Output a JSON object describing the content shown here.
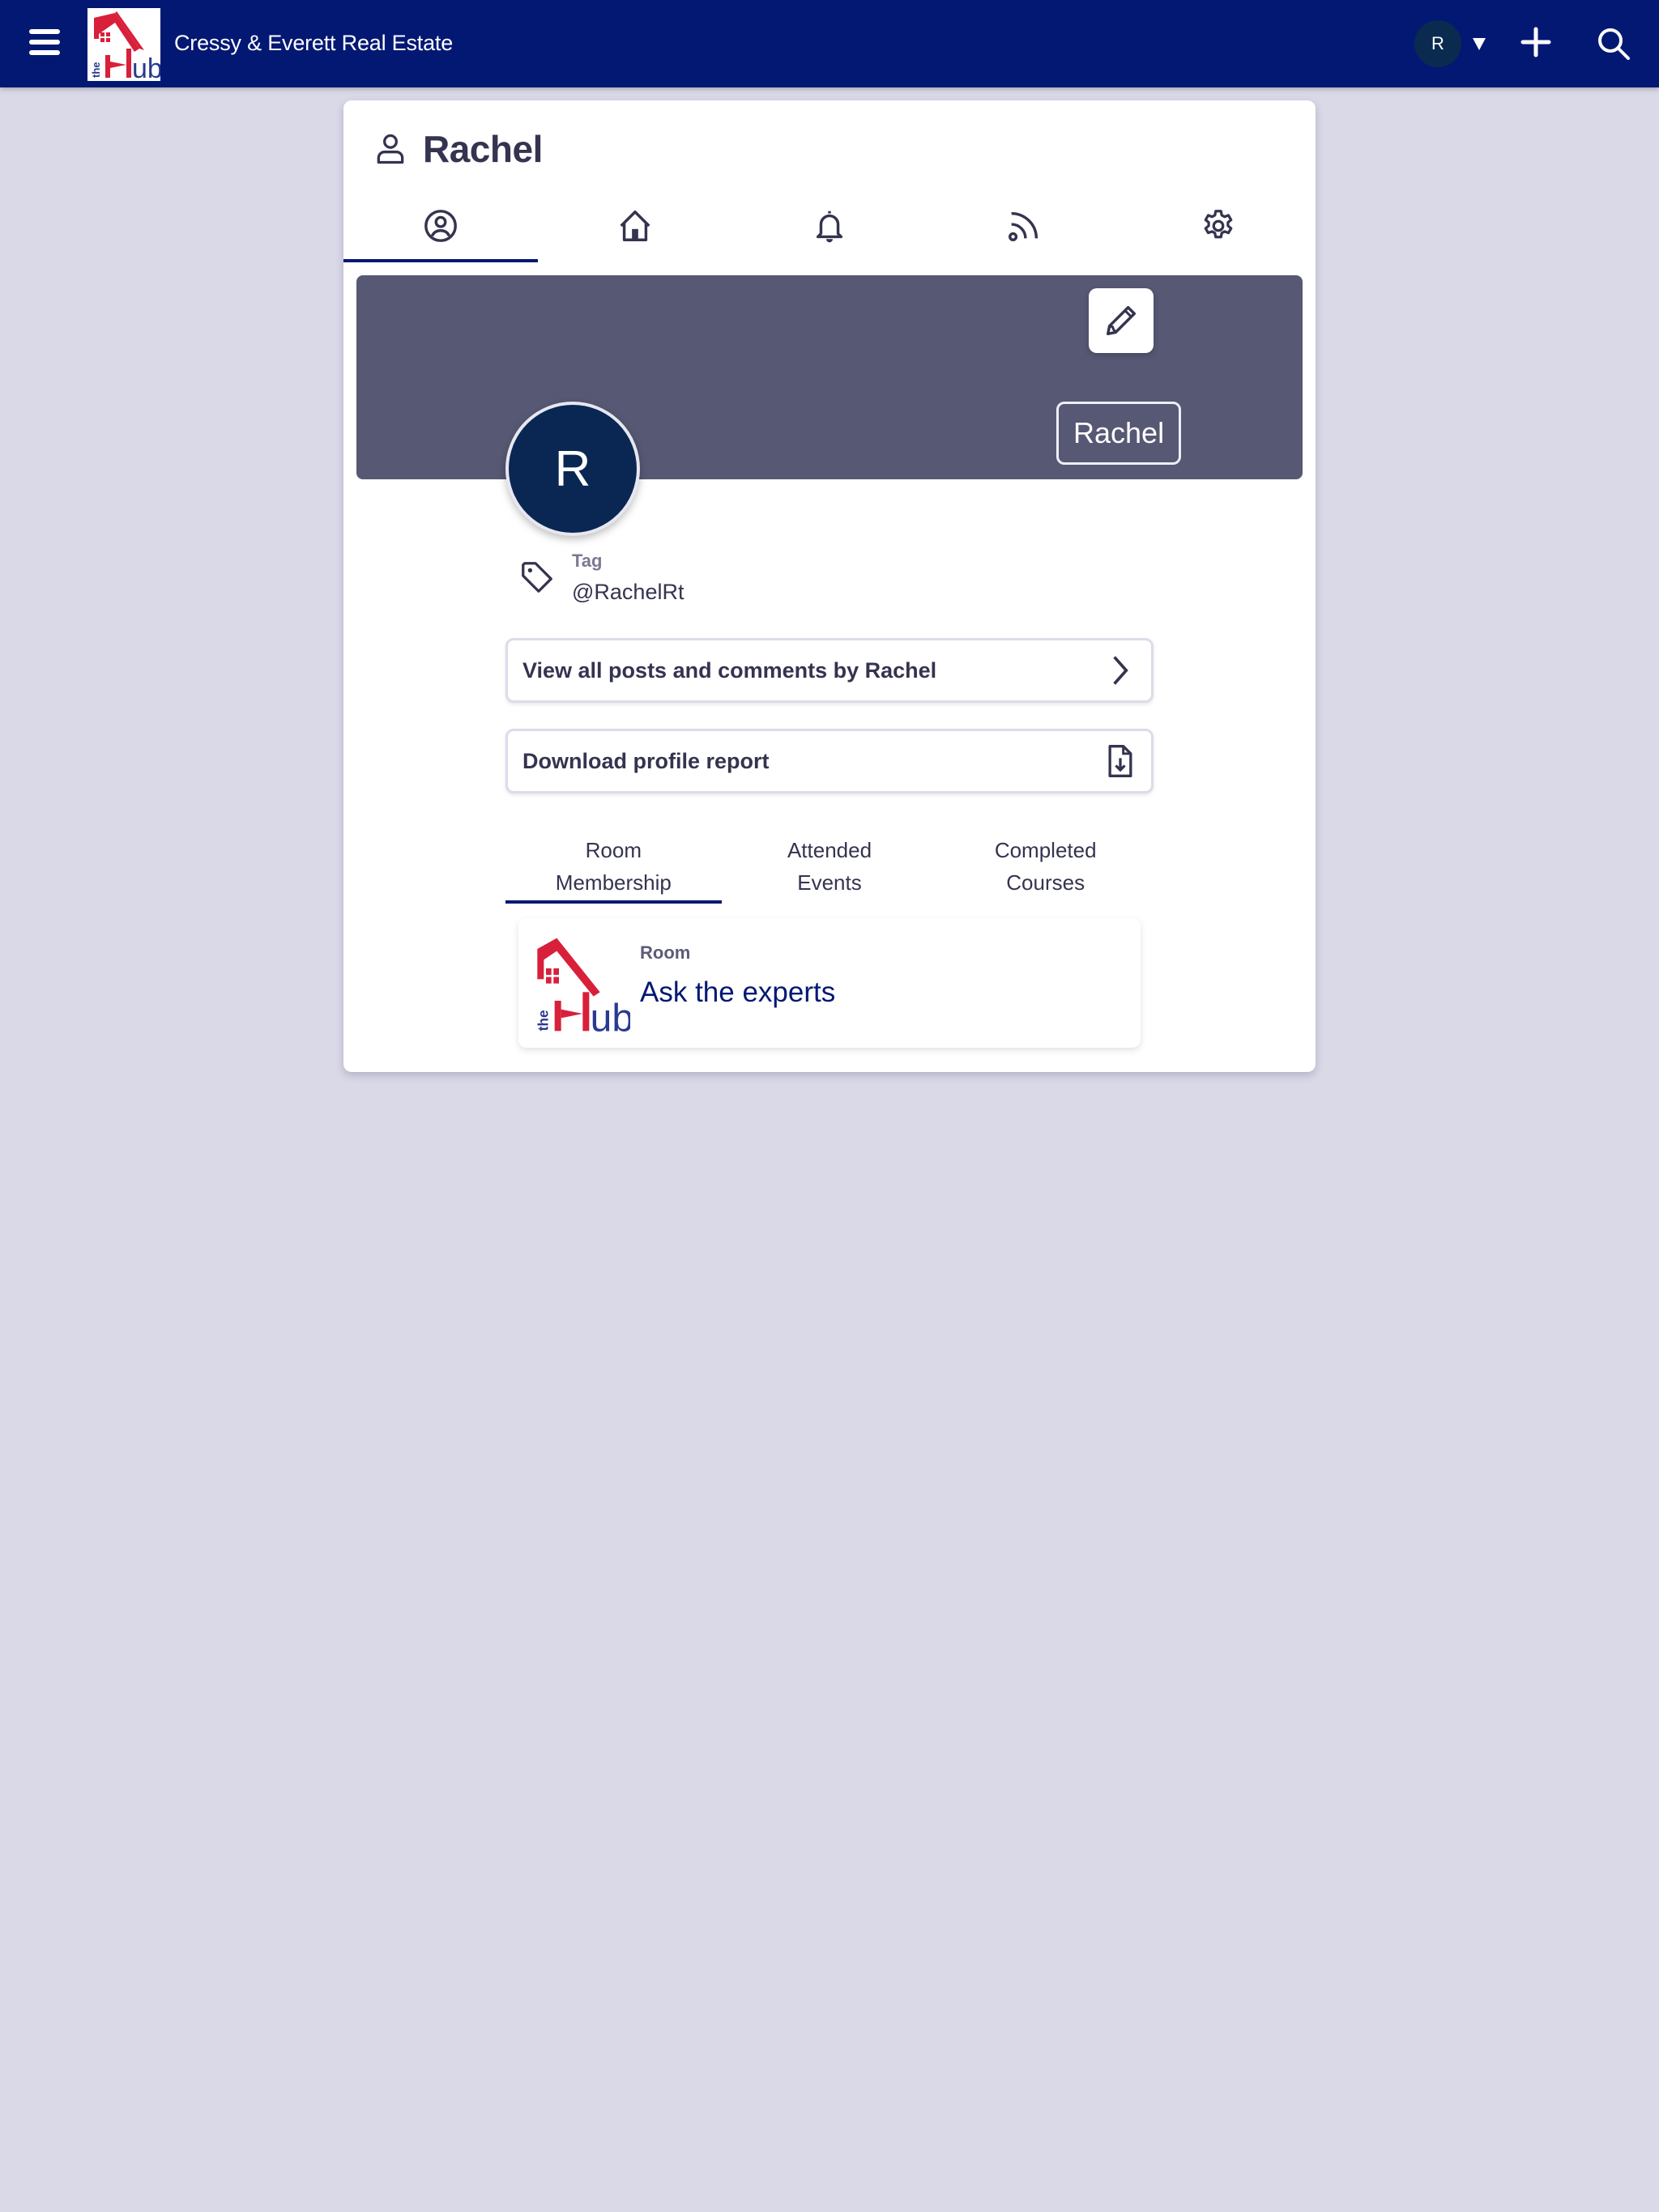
{
  "header": {
    "org_name": "Cressy & Everett Real Estate",
    "logo_alt": "the Hub",
    "user_initial": "R",
    "icons": {
      "menu": "hamburger-icon",
      "caret": "caret-down-icon",
      "create": "plus-icon",
      "search": "search-icon"
    }
  },
  "profile": {
    "title": "Rachel",
    "title_icon": "user-icon",
    "tabs": [
      {
        "name": "profile",
        "icon": "user-circle-icon",
        "active": true
      },
      {
        "name": "home",
        "icon": "home-icon",
        "active": false
      },
      {
        "name": "notifications",
        "icon": "bell-icon",
        "active": false
      },
      {
        "name": "feed",
        "icon": "rss-icon",
        "active": false
      },
      {
        "name": "settings",
        "icon": "gear-icon",
        "active": false
      }
    ],
    "cover": {
      "color": "#575874",
      "edit_icon": "pencil-icon",
      "name_badge": "Rachel"
    },
    "avatar_initial": "R",
    "tag": {
      "label": "Tag",
      "value": "@RachelRt"
    },
    "actions": {
      "view_posts": "View all posts and comments by Rachel",
      "download_report": "Download profile report"
    },
    "subtabs": [
      {
        "label": "Room Membership",
        "active": true
      },
      {
        "label": "Attended Events",
        "active": false
      },
      {
        "label": "Completed Courses",
        "active": false
      }
    ],
    "rooms": [
      {
        "type": "Room",
        "name": "Ask the experts"
      }
    ]
  },
  "colors": {
    "nav": "#031873",
    "background": "#dad9e8",
    "accent": "#031873",
    "text": "#343450",
    "logo_red": "#d8203a",
    "logo_blue": "#2a3a8f"
  }
}
